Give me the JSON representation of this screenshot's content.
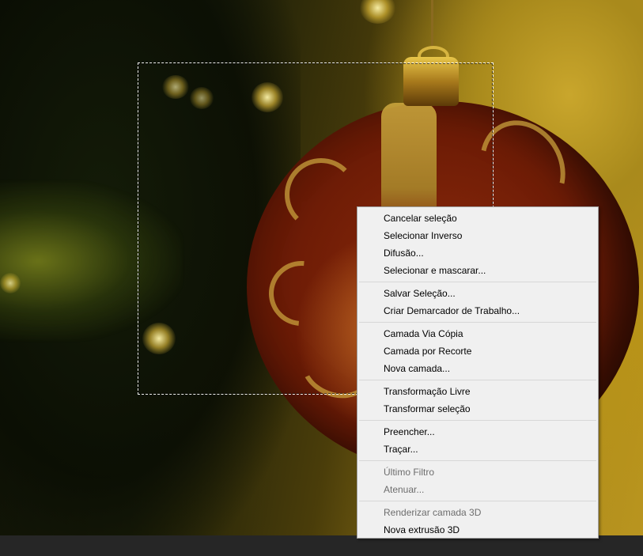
{
  "context_menu": {
    "groups": [
      {
        "items": [
          {
            "label": "Cancelar seleção",
            "enabled": true
          },
          {
            "label": "Selecionar Inverso",
            "enabled": true
          },
          {
            "label": "Difusão...",
            "enabled": true
          },
          {
            "label": "Selecionar e mascarar...",
            "enabled": true
          }
        ]
      },
      {
        "items": [
          {
            "label": "Salvar Seleção...",
            "enabled": true
          },
          {
            "label": "Criar Demarcador de Trabalho...",
            "enabled": true
          }
        ]
      },
      {
        "items": [
          {
            "label": "Camada Via Cópia",
            "enabled": true
          },
          {
            "label": "Camada por Recorte",
            "enabled": true
          },
          {
            "label": "Nova camada...",
            "enabled": true
          }
        ]
      },
      {
        "items": [
          {
            "label": "Transformação Livre",
            "enabled": true
          },
          {
            "label": "Transformar seleção",
            "enabled": true
          }
        ]
      },
      {
        "items": [
          {
            "label": "Preencher...",
            "enabled": true
          },
          {
            "label": "Traçar...",
            "enabled": true
          }
        ]
      },
      {
        "items": [
          {
            "label": "Último Filtro",
            "enabled": false
          },
          {
            "label": "Atenuar...",
            "enabled": false
          }
        ]
      },
      {
        "items": [
          {
            "label": "Renderizar camada 3D",
            "enabled": false
          },
          {
            "label": "Nova extrusão 3D",
            "enabled": true
          }
        ]
      }
    ]
  },
  "colors": {
    "menu_background": "#f0f0f0",
    "menu_text": "#000000",
    "menu_text_disabled": "#6d6d6d",
    "bottom_bar": "#262626"
  }
}
